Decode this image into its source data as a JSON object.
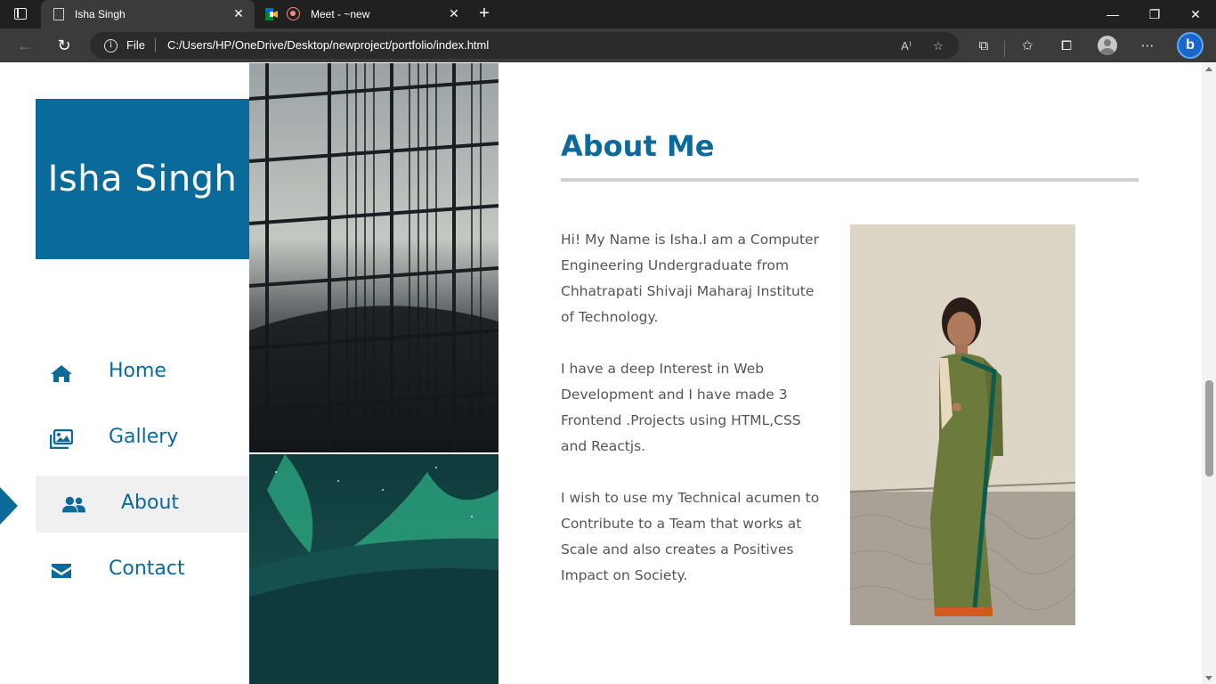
{
  "browser": {
    "tabs": [
      {
        "title": "Isha Singh",
        "active": true
      },
      {
        "title": "Meet - ~new",
        "active": false
      }
    ],
    "address": {
      "scheme_label": "File",
      "url": "C:/Users/HP/OneDrive/Desktop/newproject/portfolio/index.html"
    },
    "bing_label": "b"
  },
  "site": {
    "brand_name": "Isha Singh",
    "brand_color": "#0a6a9a",
    "nav": [
      {
        "label": "Home",
        "icon": "home-icon",
        "active": false
      },
      {
        "label": "Gallery",
        "icon": "images-icon",
        "active": false
      },
      {
        "label": "About",
        "icon": "users-icon",
        "active": true
      },
      {
        "label": "Contact",
        "icon": "envelope-icon",
        "active": false
      }
    ]
  },
  "about": {
    "title": "About Me",
    "paragraphs": [
      "Hi! My Name is Isha.I am a Computer Engineering Undergraduate from Chhatrapati Shivaji Maharaj Institute of Technology.",
      "I have a deep Interest in Web Development and I have made 3 Frontend .Projects using HTML,CSS and Reactjs.",
      "I wish to use my Technical acumen to Contribute to a Team that works at Scale and also creates a Positives Impact on Society."
    ]
  }
}
